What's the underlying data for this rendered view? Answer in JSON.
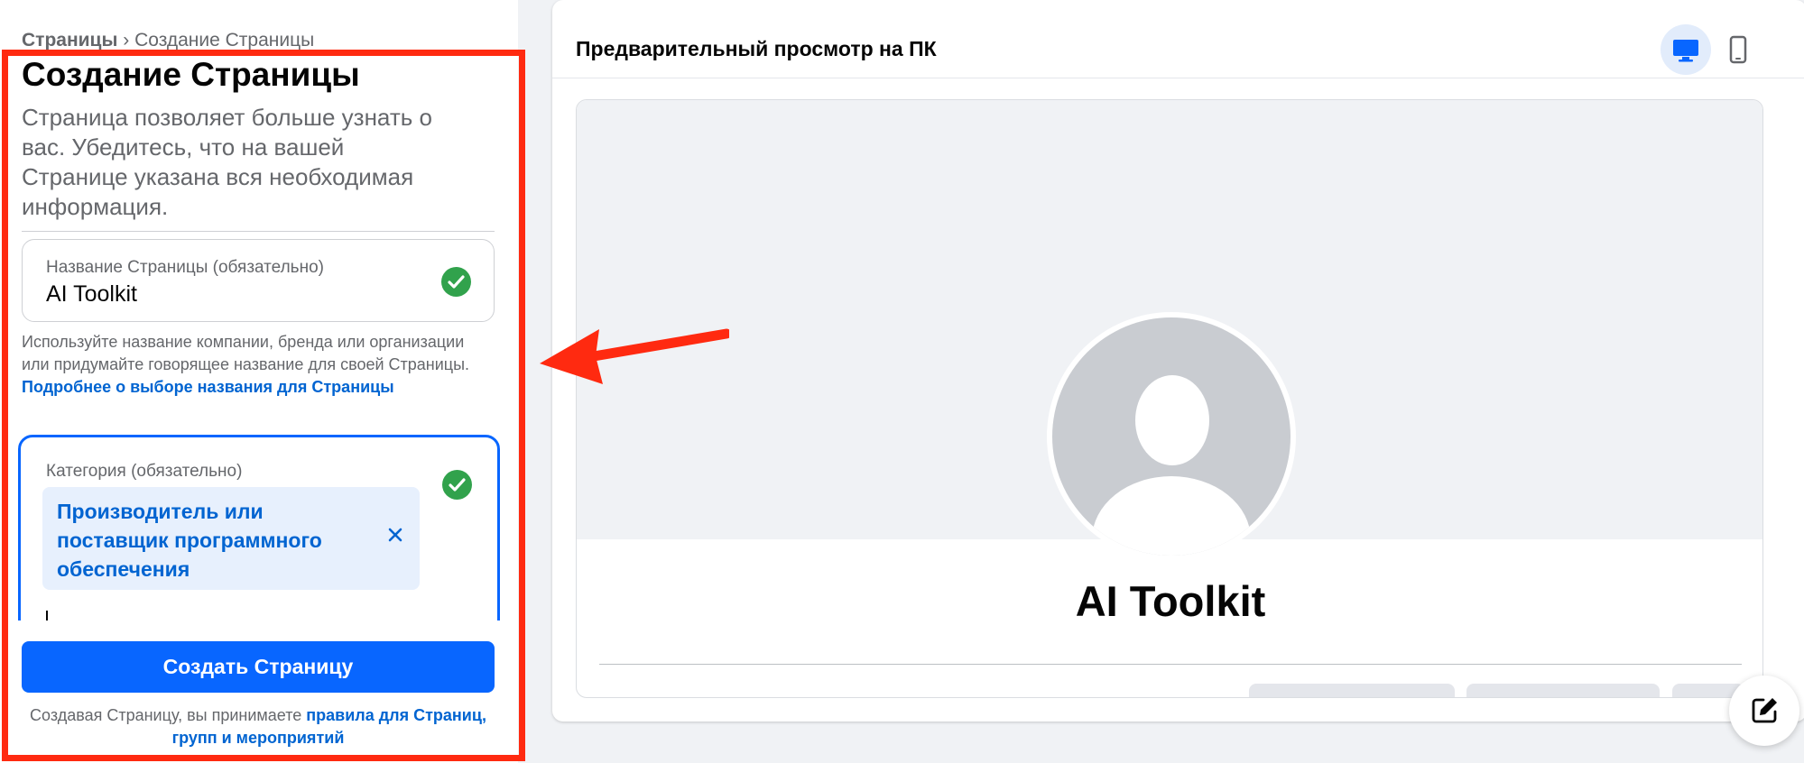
{
  "left": {
    "breadcrumb_root": "Страницы",
    "breadcrumb_sep": "›",
    "breadcrumb_current": "Создание Страницы",
    "title": "Создание Страницы",
    "description": "Страница позволяет больше узнать о вас. Убедитесь, что на вашей Странице указана вся необходимая информация.",
    "name_field": {
      "label": "Название Страницы (обязательно)",
      "value": "AI Toolkit",
      "status_icon": "check-circle-icon"
    },
    "name_helper": "Используйте название компании, бренда или организации или придумайте говорящее название для своей Страницы.",
    "name_helper_link": "Подробнее о выборе названия для Страницы",
    "category_field": {
      "label": "Категория (обязательно)",
      "selected_chip": "Производитель или поставщик программного обеспечения",
      "status_icon": "check-circle-icon"
    },
    "create_button": "Создать Страницу",
    "terms_text": "Создавая Страницу, вы принимаете",
    "terms_link": "правила для Страниц, групп и мероприятий"
  },
  "right": {
    "preview_title": "Предварительный просмотр на ПК",
    "preview_page_name": "AI Toolkit",
    "device_options": [
      "desktop-icon",
      "mobile-icon"
    ],
    "selected_device": "desktop-icon"
  },
  "colors": {
    "accent": "#0866ff",
    "link": "#0064d1",
    "success": "#31a24c",
    "highlight_annotation": "#ff2a10"
  }
}
